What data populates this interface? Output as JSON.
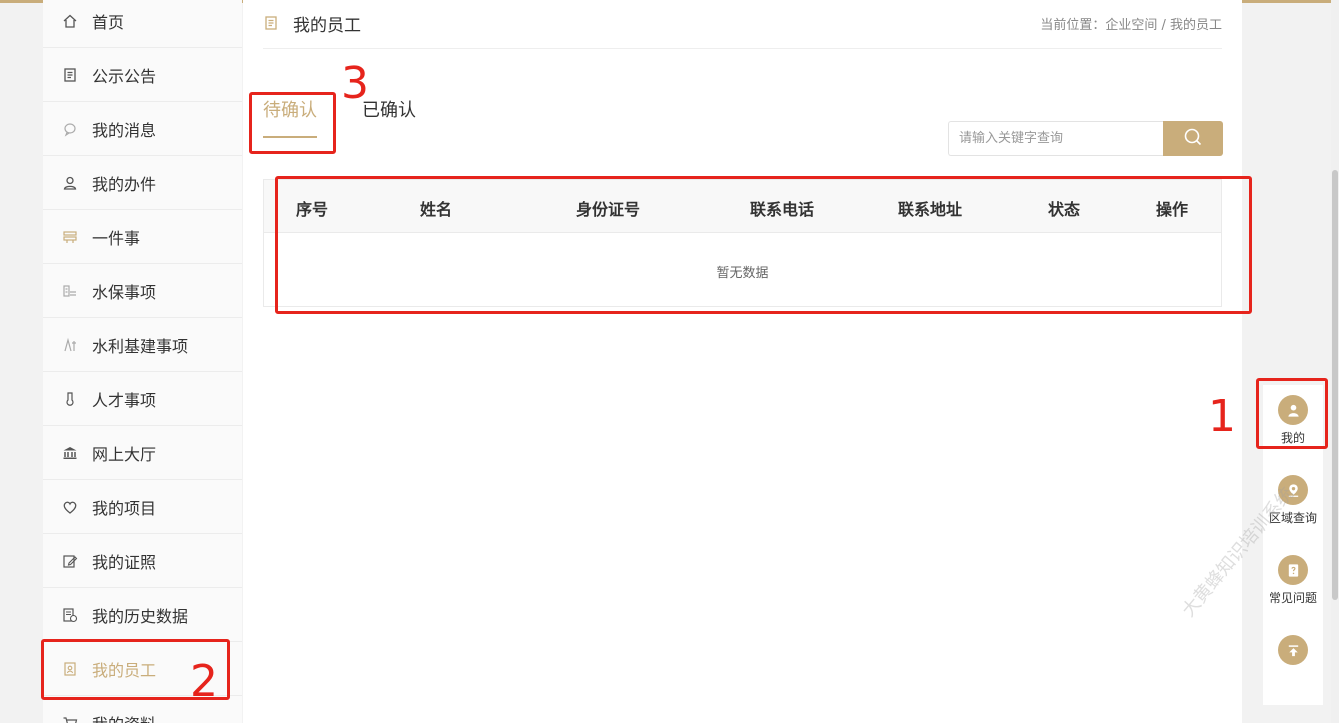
{
  "sidebar": {
    "items": [
      {
        "label": "首页",
        "icon": "home-icon"
      },
      {
        "label": "公示公告",
        "icon": "notice-icon"
      },
      {
        "label": "我的消息",
        "icon": "message-icon"
      },
      {
        "label": "我的办件",
        "icon": "user-icon"
      },
      {
        "label": "一件事",
        "icon": "stack-icon"
      },
      {
        "label": "水保事项",
        "icon": "soil-icon"
      },
      {
        "label": "水利基建事项",
        "icon": "construction-icon"
      },
      {
        "label": "人才事项",
        "icon": "talent-icon"
      },
      {
        "label": "网上大厅",
        "icon": "bank-icon"
      },
      {
        "label": "我的项目",
        "icon": "heart-icon"
      },
      {
        "label": "我的证照",
        "icon": "certificate-icon"
      },
      {
        "label": "我的历史数据",
        "icon": "history-icon"
      },
      {
        "label": "我的员工",
        "icon": "staff-icon"
      },
      {
        "label": "我的资料",
        "icon": "cart-icon"
      }
    ]
  },
  "header": {
    "title": "我的员工",
    "breadcrumb": "当前位置：企业空间 / 我的员工"
  },
  "tabs": {
    "pending": "待确认",
    "confirmed": "已确认"
  },
  "search": {
    "placeholder": "请输入关键字查询"
  },
  "table": {
    "columns": [
      "序号",
      "姓名",
      "身份证号",
      "联系电话",
      "联系地址",
      "状态",
      "操作"
    ],
    "empty_text": "暂无数据"
  },
  "floatbar": {
    "mine": "我的",
    "area_query": "区域查询",
    "faq": "常见问题"
  },
  "annotations": [
    "1",
    "2",
    "3"
  ],
  "watermark": "大黄蜂知识培训系统",
  "colors": {
    "accent": "#c9ad7b",
    "annotation": "#e6241c"
  }
}
